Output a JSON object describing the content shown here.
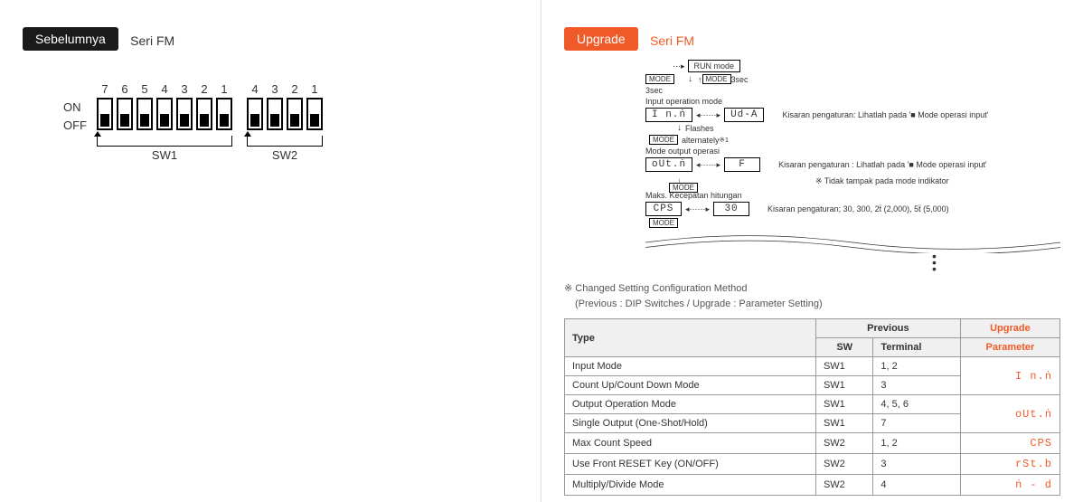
{
  "left": {
    "badge": "Sebelumnya",
    "series": "Seri FM",
    "dip": {
      "on": "ON",
      "off": "OFF",
      "sw1_nums": [
        "7",
        "6",
        "5",
        "4",
        "3",
        "2",
        "1"
      ],
      "sw2_nums": [
        "4",
        "3",
        "2",
        "1"
      ],
      "sw1_label": "SW1",
      "sw2_label": "SW2"
    }
  },
  "right": {
    "badge": "Upgrade",
    "series": "Seri FM",
    "flow": {
      "run_mode": "RUN mode",
      "mode_badge": "MODE",
      "three_sec": "3sec",
      "input_op_mode_label": "Input operation mode",
      "input_op_lcd": "I n.ṅ",
      "flashes": "Flashes",
      "alternately": "alternately",
      "star1": "※1",
      "ud_a": "Ud-A",
      "desc1": "Kisaran pengaturan: Lihatlah pada '■ Mode operasi input'",
      "mode_output_label": "Mode output operasi",
      "out_lcd": "oUt.ṅ",
      "f_lcd": "F",
      "desc2a": "Kisaran pengaturan : Lihatlah pada '■ Mode operasi input'",
      "desc2b": "※ Tidak tampak pada mode indikator",
      "max_count_label": "Maks. Kecepatan hitungan",
      "cps_lcd": "CPS",
      "thirty": "30",
      "desc3": "Kisaran pengaturan; 30, 300, 2ẗ (2,000), 5ẗ (5,000)"
    },
    "note1": "※ Changed Setting Configuration Method",
    "note2": "(Previous : DIP Switches / Upgrade : Parameter Setting)",
    "table": {
      "h_type": "Type",
      "h_previous": "Previous",
      "h_upgrade": "Upgrade",
      "h_sw": "SW",
      "h_terminal": "Terminal",
      "h_parameter": "Parameter",
      "rows": [
        {
          "type": "Input Mode",
          "sw": "SW1",
          "term": "1, 2",
          "param": "I n.ṅ",
          "rowspan": 2
        },
        {
          "type": "Count Up/Count Down Mode",
          "sw": "SW1",
          "term": "3"
        },
        {
          "type": "Output Operation Mode",
          "sw": "SW1",
          "term": "4, 5, 6",
          "param": "oUt.ṅ",
          "rowspan": 2
        },
        {
          "type": "Single Output (One-Shot/Hold)",
          "sw": "SW1",
          "term": "7"
        },
        {
          "type": "Max Count Speed",
          "sw": "SW2",
          "term": "1, 2",
          "param": "CPS"
        },
        {
          "type": "Use Front RESET Key (ON/OFF)",
          "sw": "SW2",
          "term": "3",
          "param": "rSt.b"
        },
        {
          "type": "Multiply/Divide Mode",
          "sw": "SW2",
          "term": "4",
          "param": "ṅ - d"
        }
      ]
    }
  }
}
